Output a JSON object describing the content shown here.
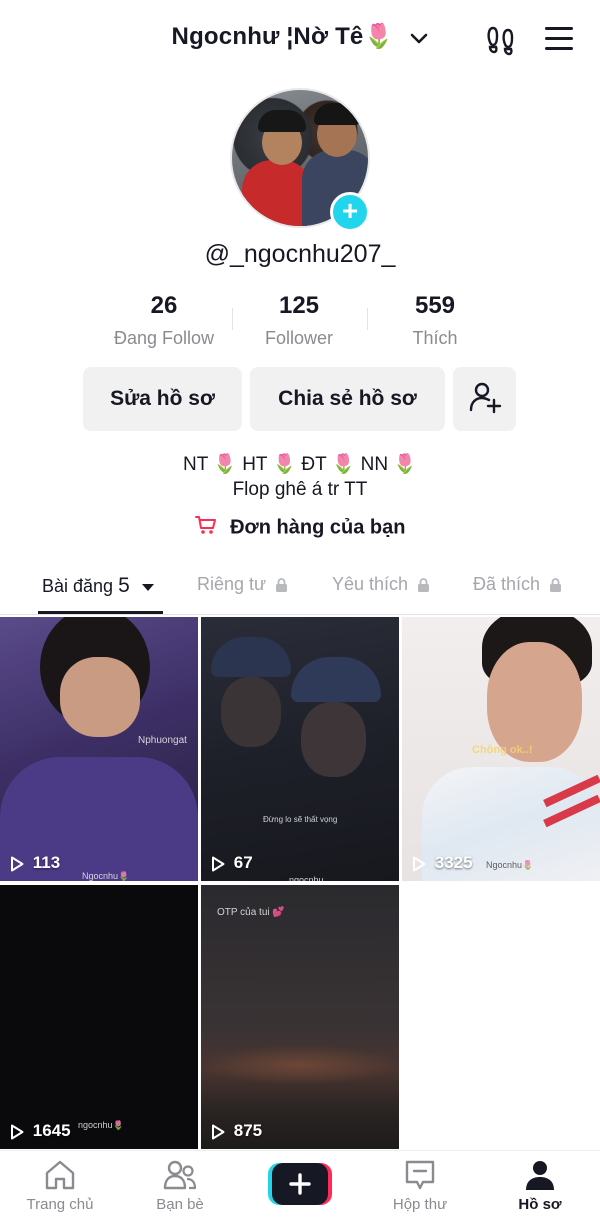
{
  "header": {
    "profile_name": "Ngocnhư ¦Nờ Tê🌷",
    "icons": [
      "chevron-down-icon",
      "footprints-icon",
      "hamburger-menu-icon"
    ]
  },
  "profile": {
    "username": "@_ngocnhu207_",
    "stats": [
      {
        "value": "26",
        "label": "Đang Follow"
      },
      {
        "value": "125",
        "label": "Follower"
      },
      {
        "value": "559",
        "label": "Thích"
      }
    ],
    "buttons": {
      "edit": "Sửa hồ sơ",
      "share": "Chia sẻ hồ sơ"
    },
    "bio_line1": "NT 🌷 HT 🌷 ĐT 🌷 NN 🌷",
    "bio_line2": "Flop ghê á tr TT",
    "orders": "Đơn hàng của bạn"
  },
  "tabs": {
    "posts_label": "Bài đăng",
    "posts_count": "5",
    "private": "Riêng tư",
    "favorites": "Yêu thích",
    "liked": "Đã thích"
  },
  "videos": [
    {
      "views": "113",
      "watermark": "Ngocnhu🌷",
      "caption": "Nphuongat"
    },
    {
      "views": "67",
      "watermark": "ngocnhu",
      "caption": "Đừng lo sẽ thất vọng"
    },
    {
      "views": "3325",
      "watermark": "Ngocnhu🌷",
      "caption": "Chồng ok..!"
    },
    {
      "views": "1645",
      "watermark": "ngocnhu🌷",
      "caption": ""
    },
    {
      "views": "875",
      "watermark": "",
      "caption": "OTP của tui 💕"
    }
  ],
  "nav": {
    "home": "Trang chủ",
    "friends": "Bạn bè",
    "inbox": "Hộp thư",
    "profile": "Hồ sơ"
  },
  "colors": {
    "accent_teal": "#20d5ec",
    "accent_red": "#fe2c55",
    "text_primary": "#161823",
    "text_secondary": "#8a8b91",
    "button_bg": "#f1f1f2"
  }
}
